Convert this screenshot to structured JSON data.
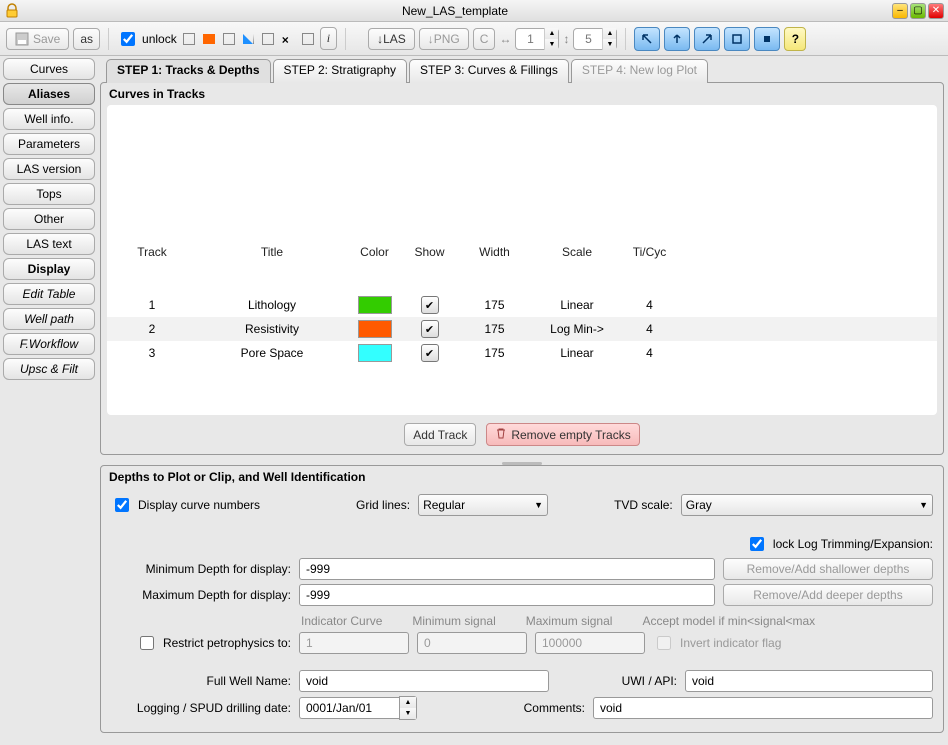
{
  "window": {
    "title": "New_LAS_template"
  },
  "toolbar": {
    "save": "Save",
    "as": "as",
    "unlock": "unlock",
    "i": "i",
    "las": "↓LAS",
    "png": "↓PNG",
    "c": "C",
    "hspin_prefix": "↔",
    "hspin": "1",
    "vspin_prefix": "↕",
    "vspin": "5"
  },
  "sidebar": [
    {
      "label": "Curves",
      "style": ""
    },
    {
      "label": "Aliases",
      "style": "bold selected"
    },
    {
      "label": "Well info.",
      "style": ""
    },
    {
      "label": "Parameters",
      "style": ""
    },
    {
      "label": "LAS version",
      "style": ""
    },
    {
      "label": "Tops",
      "style": ""
    },
    {
      "label": "Other",
      "style": ""
    },
    {
      "label": "LAS text",
      "style": ""
    },
    {
      "label": "Display",
      "style": "bold"
    },
    {
      "label": "Edit Table",
      "style": "italic"
    },
    {
      "label": "Well path",
      "style": "italic"
    },
    {
      "label": "F.Workflow",
      "style": "italic"
    },
    {
      "label": "Upsc & Filt",
      "style": "italic"
    }
  ],
  "steps": [
    {
      "label": "STEP 1: Tracks & Depths",
      "state": "active"
    },
    {
      "label": "STEP 2: Stratigraphy",
      "state": ""
    },
    {
      "label": "STEP 3: Curves & Fillings",
      "state": ""
    },
    {
      "label": "STEP 4: New log Plot",
      "state": "disabled"
    }
  ],
  "curves_panel": {
    "title": "Curves in Tracks",
    "headers": {
      "track": "Track",
      "title": "Title",
      "color": "Color",
      "show": "Show",
      "width": "Width",
      "scale": "Scale",
      "ticyc": "Ti/Cyc"
    },
    "rows": [
      {
        "track": "1",
        "title": "Lithology",
        "color": "#33cc00",
        "show": true,
        "width": "175",
        "scale": "Linear",
        "ticyc": "4"
      },
      {
        "track": "2",
        "title": "Resistivity",
        "color": "#ff5a00",
        "show": true,
        "width": "175",
        "scale": "Log Min->",
        "ticyc": "4"
      },
      {
        "track": "3",
        "title": "Pore Space",
        "color": "#33ffff",
        "show": true,
        "width": "175",
        "scale": "Linear",
        "ticyc": "4"
      }
    ],
    "add_btn": "Add Track",
    "remove_btn": "Remove empty Tracks"
  },
  "depths_panel": {
    "title": "Depths to Plot or Clip, and Well Identification",
    "display_curve_numbers": "Display curve numbers",
    "grid_lines_label": "Grid lines:",
    "grid_lines_value": "Regular",
    "tvd_scale_label": "TVD scale:",
    "tvd_scale_value": "Gray",
    "lock_trim": "lock Log Trimming/Expansion:",
    "min_depth_label": "Minimum Depth for display:",
    "min_depth": "-999",
    "max_depth_label": "Maximum Depth for display:",
    "max_depth": "-999",
    "remove_shallow": "Remove/Add shallower depths",
    "remove_deep": "Remove/Add deeper depths",
    "heads": {
      "ind": "Indicator Curve",
      "min": "Minimum signal",
      "max": "Maximum signal",
      "acc": "Accept model if min<signal<max"
    },
    "restrict_label": "Restrict petrophysics to:",
    "ind_val": "1",
    "min_val": "0",
    "max_val": "100000",
    "invert_label": "Invert indicator flag",
    "full_well_label": "Full Well Name:",
    "full_well": "void",
    "uwi_label": "UWI / API:",
    "uwi": "void",
    "date_label": "Logging / SPUD drilling date:",
    "date": "0001/Jan/01",
    "comments_label": "Comments:",
    "comments": "void"
  }
}
